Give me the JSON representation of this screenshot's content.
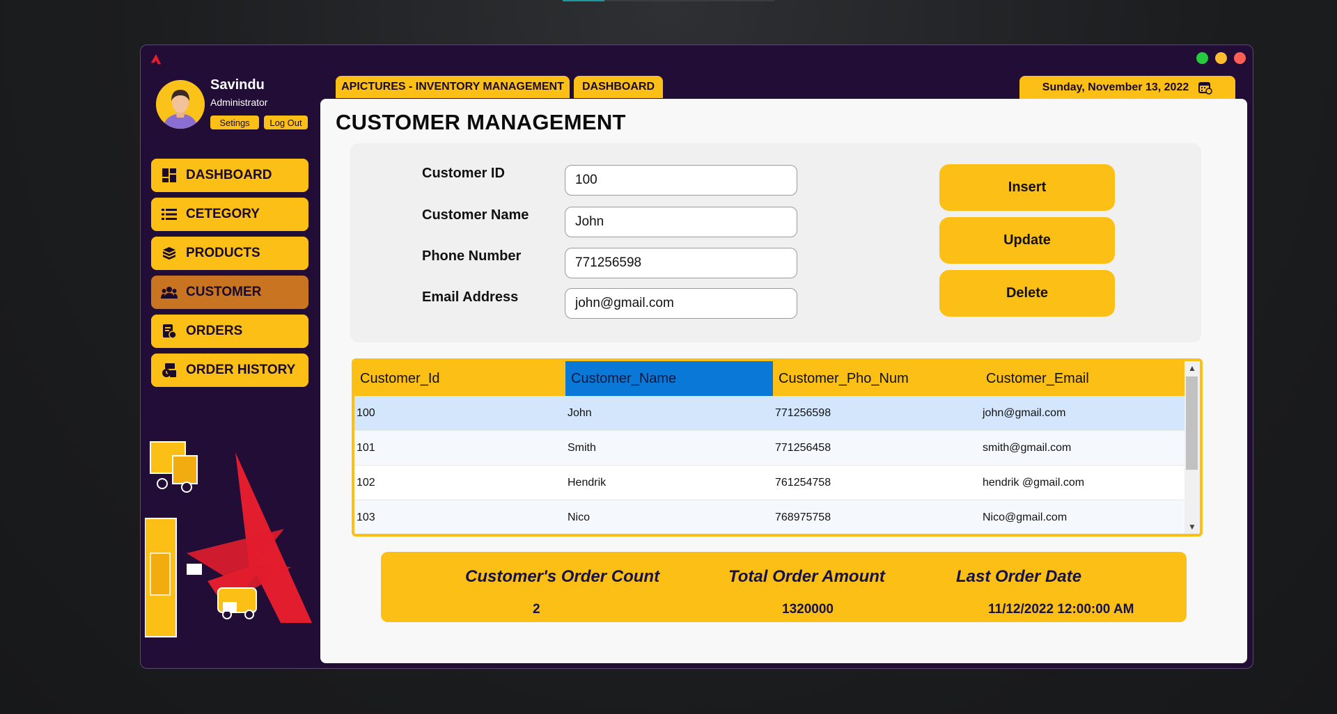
{
  "user": {
    "name": "Savindu",
    "role": "Administrator",
    "settings_label": "Setings",
    "logout_label": "Log Out"
  },
  "nav": [
    {
      "label": "DASHBOARD",
      "icon": "dashboard-icon"
    },
    {
      "label": "CETEGORY",
      "icon": "list-icon"
    },
    {
      "label": "PRODUCTS",
      "icon": "boxes-icon"
    },
    {
      "label": "CUSTOMER",
      "icon": "users-icon",
      "active": true
    },
    {
      "label": "ORDERS",
      "icon": "orders-icon"
    },
    {
      "label": "ORDER HISTORY",
      "icon": "history-icon"
    }
  ],
  "tabs": {
    "app": "APICTURES - INVENTORY MANAGEMENT",
    "dashboard": "DASHBOARD"
  },
  "date": "Sunday, November 13, 2022",
  "page_title": "CUSTOMER MANAGEMENT",
  "form": {
    "id_label": "Customer ID",
    "id_value": "100",
    "name_label": "Customer Name",
    "name_value": "John",
    "phone_label": "Phone Number",
    "phone_value": "771256598",
    "email_label": "Email Address",
    "email_value": "john@gmail.com"
  },
  "actions": {
    "insert": "Insert",
    "update": "Update",
    "delete": "Delete"
  },
  "table": {
    "columns": [
      "Customer_Id",
      "Customer_Name",
      "Customer_Pho_Num",
      "Customer_Email"
    ],
    "rows": [
      [
        "100",
        "John",
        "771256598",
        "john@gmail.com"
      ],
      [
        "101",
        "Smith",
        "771256458",
        "smith@gmail.com"
      ],
      [
        "102",
        "Hendrik",
        "761254758",
        "hendrik @gmail.com"
      ],
      [
        "103",
        "Nico",
        "768975758",
        "Nico@gmail.com"
      ]
    ]
  },
  "summary": {
    "order_count_label": "Customer's Order Count",
    "order_count": "2",
    "total_label": "Total Order Amount",
    "total": "1320000",
    "last_date_label": "Last Order Date",
    "last_date": "11/12/2022 12:00:00 AM"
  },
  "colors": {
    "accent": "#fbbf16",
    "sidebar": "#210d36",
    "active_nav": "#c97421",
    "selected_header": "#0a78d7"
  }
}
